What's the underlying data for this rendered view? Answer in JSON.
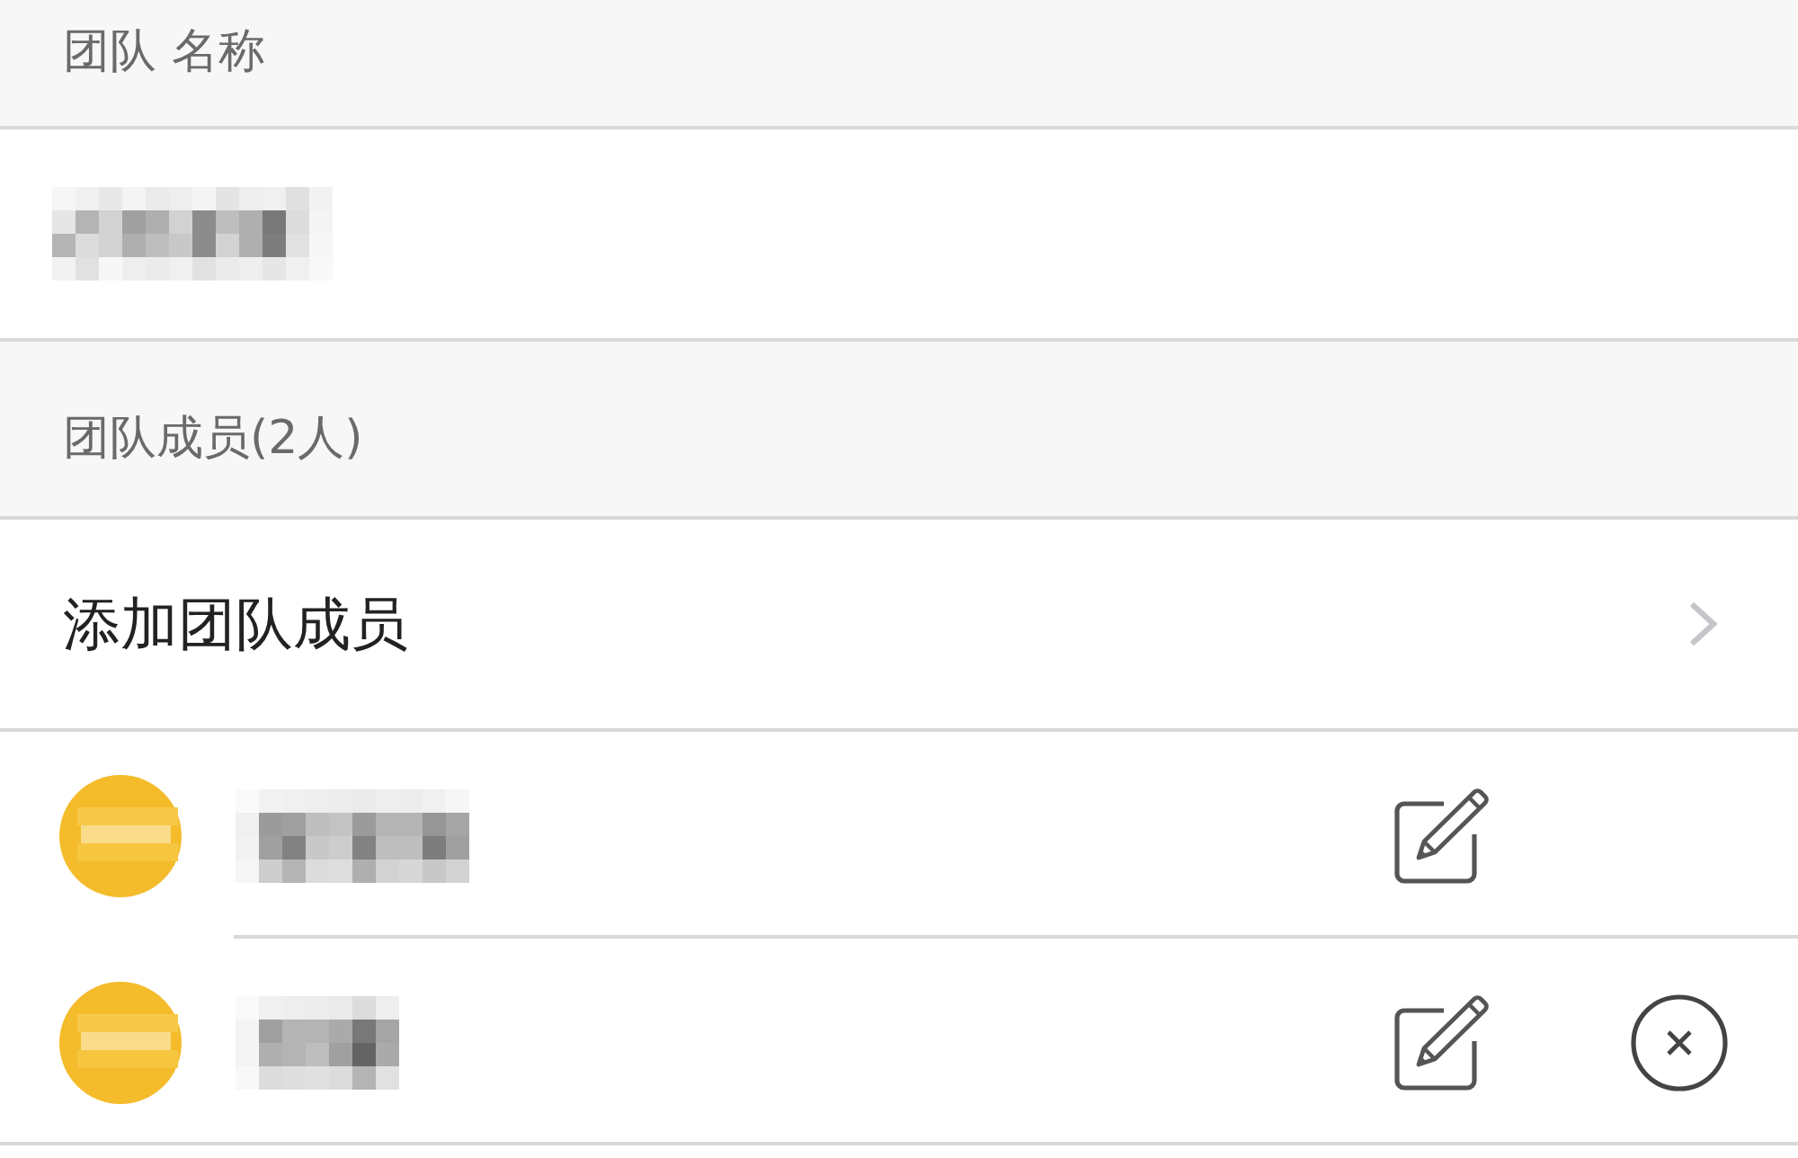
{
  "team_name_section": {
    "header": "团队 名称"
  },
  "members_section": {
    "header": "团队成员(2人)",
    "add_member": {
      "label": "添加团队成员"
    }
  },
  "members": [
    {
      "editable": true,
      "removable": false
    },
    {
      "editable": true,
      "removable": true
    }
  ]
}
